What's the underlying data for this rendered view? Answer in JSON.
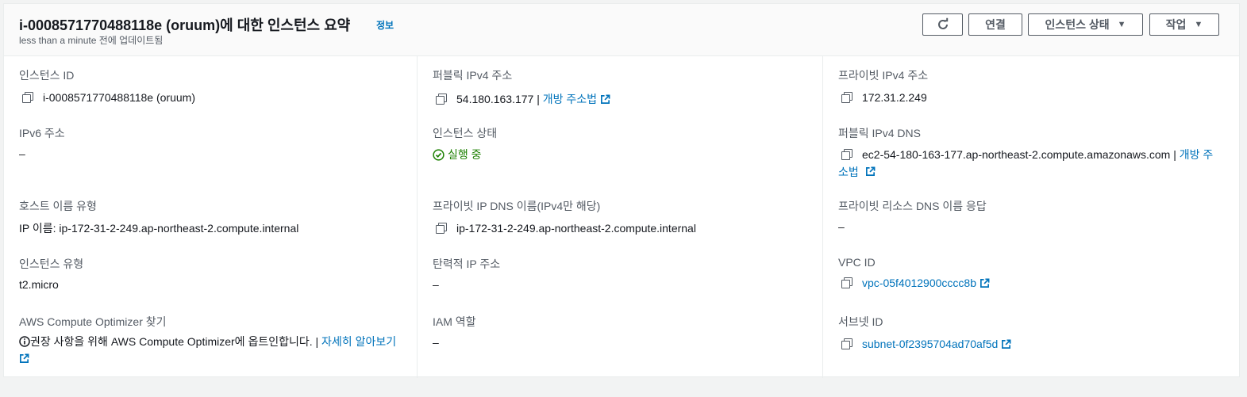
{
  "header": {
    "title": "i-0008571770488118e (oruum)에 대한 인스턴스 요약",
    "info_link": "정보",
    "subtitle": "less than a minute 전에 업데이트됨",
    "buttons": {
      "refresh_icon": "refresh-icon",
      "connect": "연결",
      "instance_state": "인스턴스 상태",
      "actions": "작업"
    }
  },
  "col1": {
    "instance_id": {
      "label": "인스턴스 ID",
      "value": "i-0008571770488118e (oruum)"
    },
    "ipv6": {
      "label": "IPv6 주소",
      "value": "–"
    },
    "hostname_type": {
      "label": "호스트 이름 유형",
      "value": "IP 이름: ip-172-31-2-249.ap-northeast-2.compute.internal"
    },
    "instance_type": {
      "label": "인스턴스 유형",
      "value": "t2.micro"
    },
    "optimizer": {
      "label": "AWS Compute Optimizer 찾기",
      "text": "권장 사항을 위해 AWS Compute Optimizer에 옵트인합니다. |",
      "link": "자세히 알아보기"
    }
  },
  "col2": {
    "public_ipv4": {
      "label": "퍼블릭 IPv4 주소",
      "value": "54.180.163.177 |",
      "link": "개방 주소법"
    },
    "instance_state": {
      "label": "인스턴스 상태",
      "value": "실행 중"
    },
    "private_dns": {
      "label": "프라이빗 IP DNS 이름(IPv4만 해당)",
      "value": "ip-172-31-2-249.ap-northeast-2.compute.internal"
    },
    "elastic_ip": {
      "label": "탄력적 IP 주소",
      "value": "–"
    },
    "iam_role": {
      "label": "IAM 역할",
      "value": "–"
    }
  },
  "col3": {
    "private_ipv4": {
      "label": "프라이빗 IPv4 주소",
      "value": "172.31.2.249"
    },
    "public_dns": {
      "label": "퍼블릭 IPv4 DNS",
      "value": "ec2-54-180-163-177.ap-northeast-2.compute.amazonaws.com |",
      "link_part1": "개방 주",
      "link_part2": "소법"
    },
    "resource_dns": {
      "label": "프라이빗 리소스 DNS 이름 응답",
      "value": "–"
    },
    "vpc_id": {
      "label": "VPC ID",
      "value": "vpc-05f4012900cccc8b"
    },
    "subnet_id": {
      "label": "서브넷 ID",
      "value": "subnet-0f2395704ad70af5d"
    }
  },
  "colors": {
    "link": "#0073bb",
    "success": "#1d8102",
    "accent": "#ec7211"
  }
}
